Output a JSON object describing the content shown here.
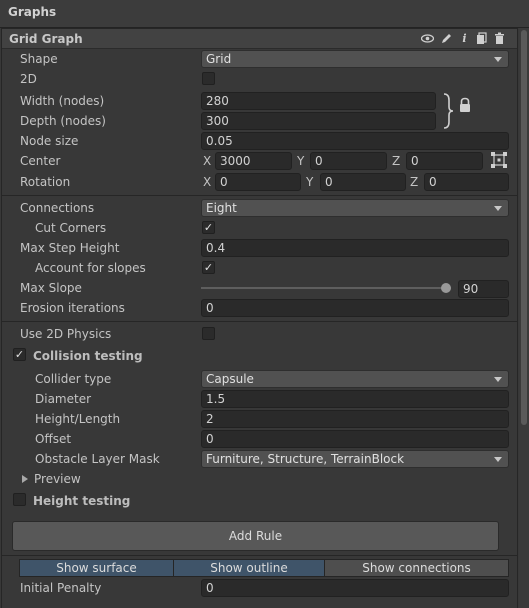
{
  "header": {
    "title": "Graphs"
  },
  "graph": {
    "title": "Grid Graph"
  },
  "fields": {
    "shape": {
      "label": "Shape",
      "value": "Grid"
    },
    "two_d": {
      "label": "2D",
      "checked": false
    },
    "width": {
      "label": "Width (nodes)",
      "value": "280"
    },
    "depth": {
      "label": "Depth (nodes)",
      "value": "300"
    },
    "node_size": {
      "label": "Node size",
      "value": "0.05"
    },
    "center": {
      "label": "Center",
      "x_label": "X",
      "x": "3000",
      "y_label": "Y",
      "y": "0",
      "z_label": "Z",
      "z": "0"
    },
    "rotation": {
      "label": "Rotation",
      "x_label": "X",
      "x": "0",
      "y_label": "Y",
      "y": "0",
      "z_label": "Z",
      "z": "0"
    },
    "connections": {
      "label": "Connections",
      "value": "Eight"
    },
    "cut_corners": {
      "label": "Cut Corners",
      "checked": true
    },
    "max_step_height": {
      "label": "Max Step Height",
      "value": "0.4"
    },
    "account_slopes": {
      "label": "Account for slopes",
      "checked": true
    },
    "max_slope": {
      "label": "Max Slope",
      "value": "90",
      "fraction": 1.0
    },
    "erosion": {
      "label": "Erosion iterations",
      "value": "0"
    },
    "use_2d_physics": {
      "label": "Use 2D Physics",
      "checked": false
    },
    "collision_testing": {
      "label": "Collision testing",
      "checked": true
    },
    "collider_type": {
      "label": "Collider type",
      "value": "Capsule"
    },
    "diameter": {
      "label": "Diameter",
      "value": "1.5"
    },
    "height_length": {
      "label": "Height/Length",
      "value": "2"
    },
    "offset": {
      "label": "Offset",
      "value": "0"
    },
    "obstacle_mask": {
      "label": "Obstacle Layer Mask",
      "value": "Furniture, Structure, TerrainBlock"
    },
    "preview": {
      "label": "Preview"
    },
    "height_testing": {
      "label": "Height testing",
      "checked": false
    },
    "initial_penalty": {
      "label": "Initial Penalty",
      "value": "0"
    }
  },
  "buttons": {
    "add_rule": "Add Rule",
    "show_surface": "Show surface",
    "show_outline": "Show outline",
    "show_connections": "Show connections"
  },
  "icons": [
    "eye-icon",
    "pencil-icon",
    "info-icon",
    "copy-icon",
    "trash-icon",
    "lock-icon",
    "snap-icon"
  ],
  "colors": {
    "background": "#383838",
    "toggle_on": "#3f5469"
  }
}
